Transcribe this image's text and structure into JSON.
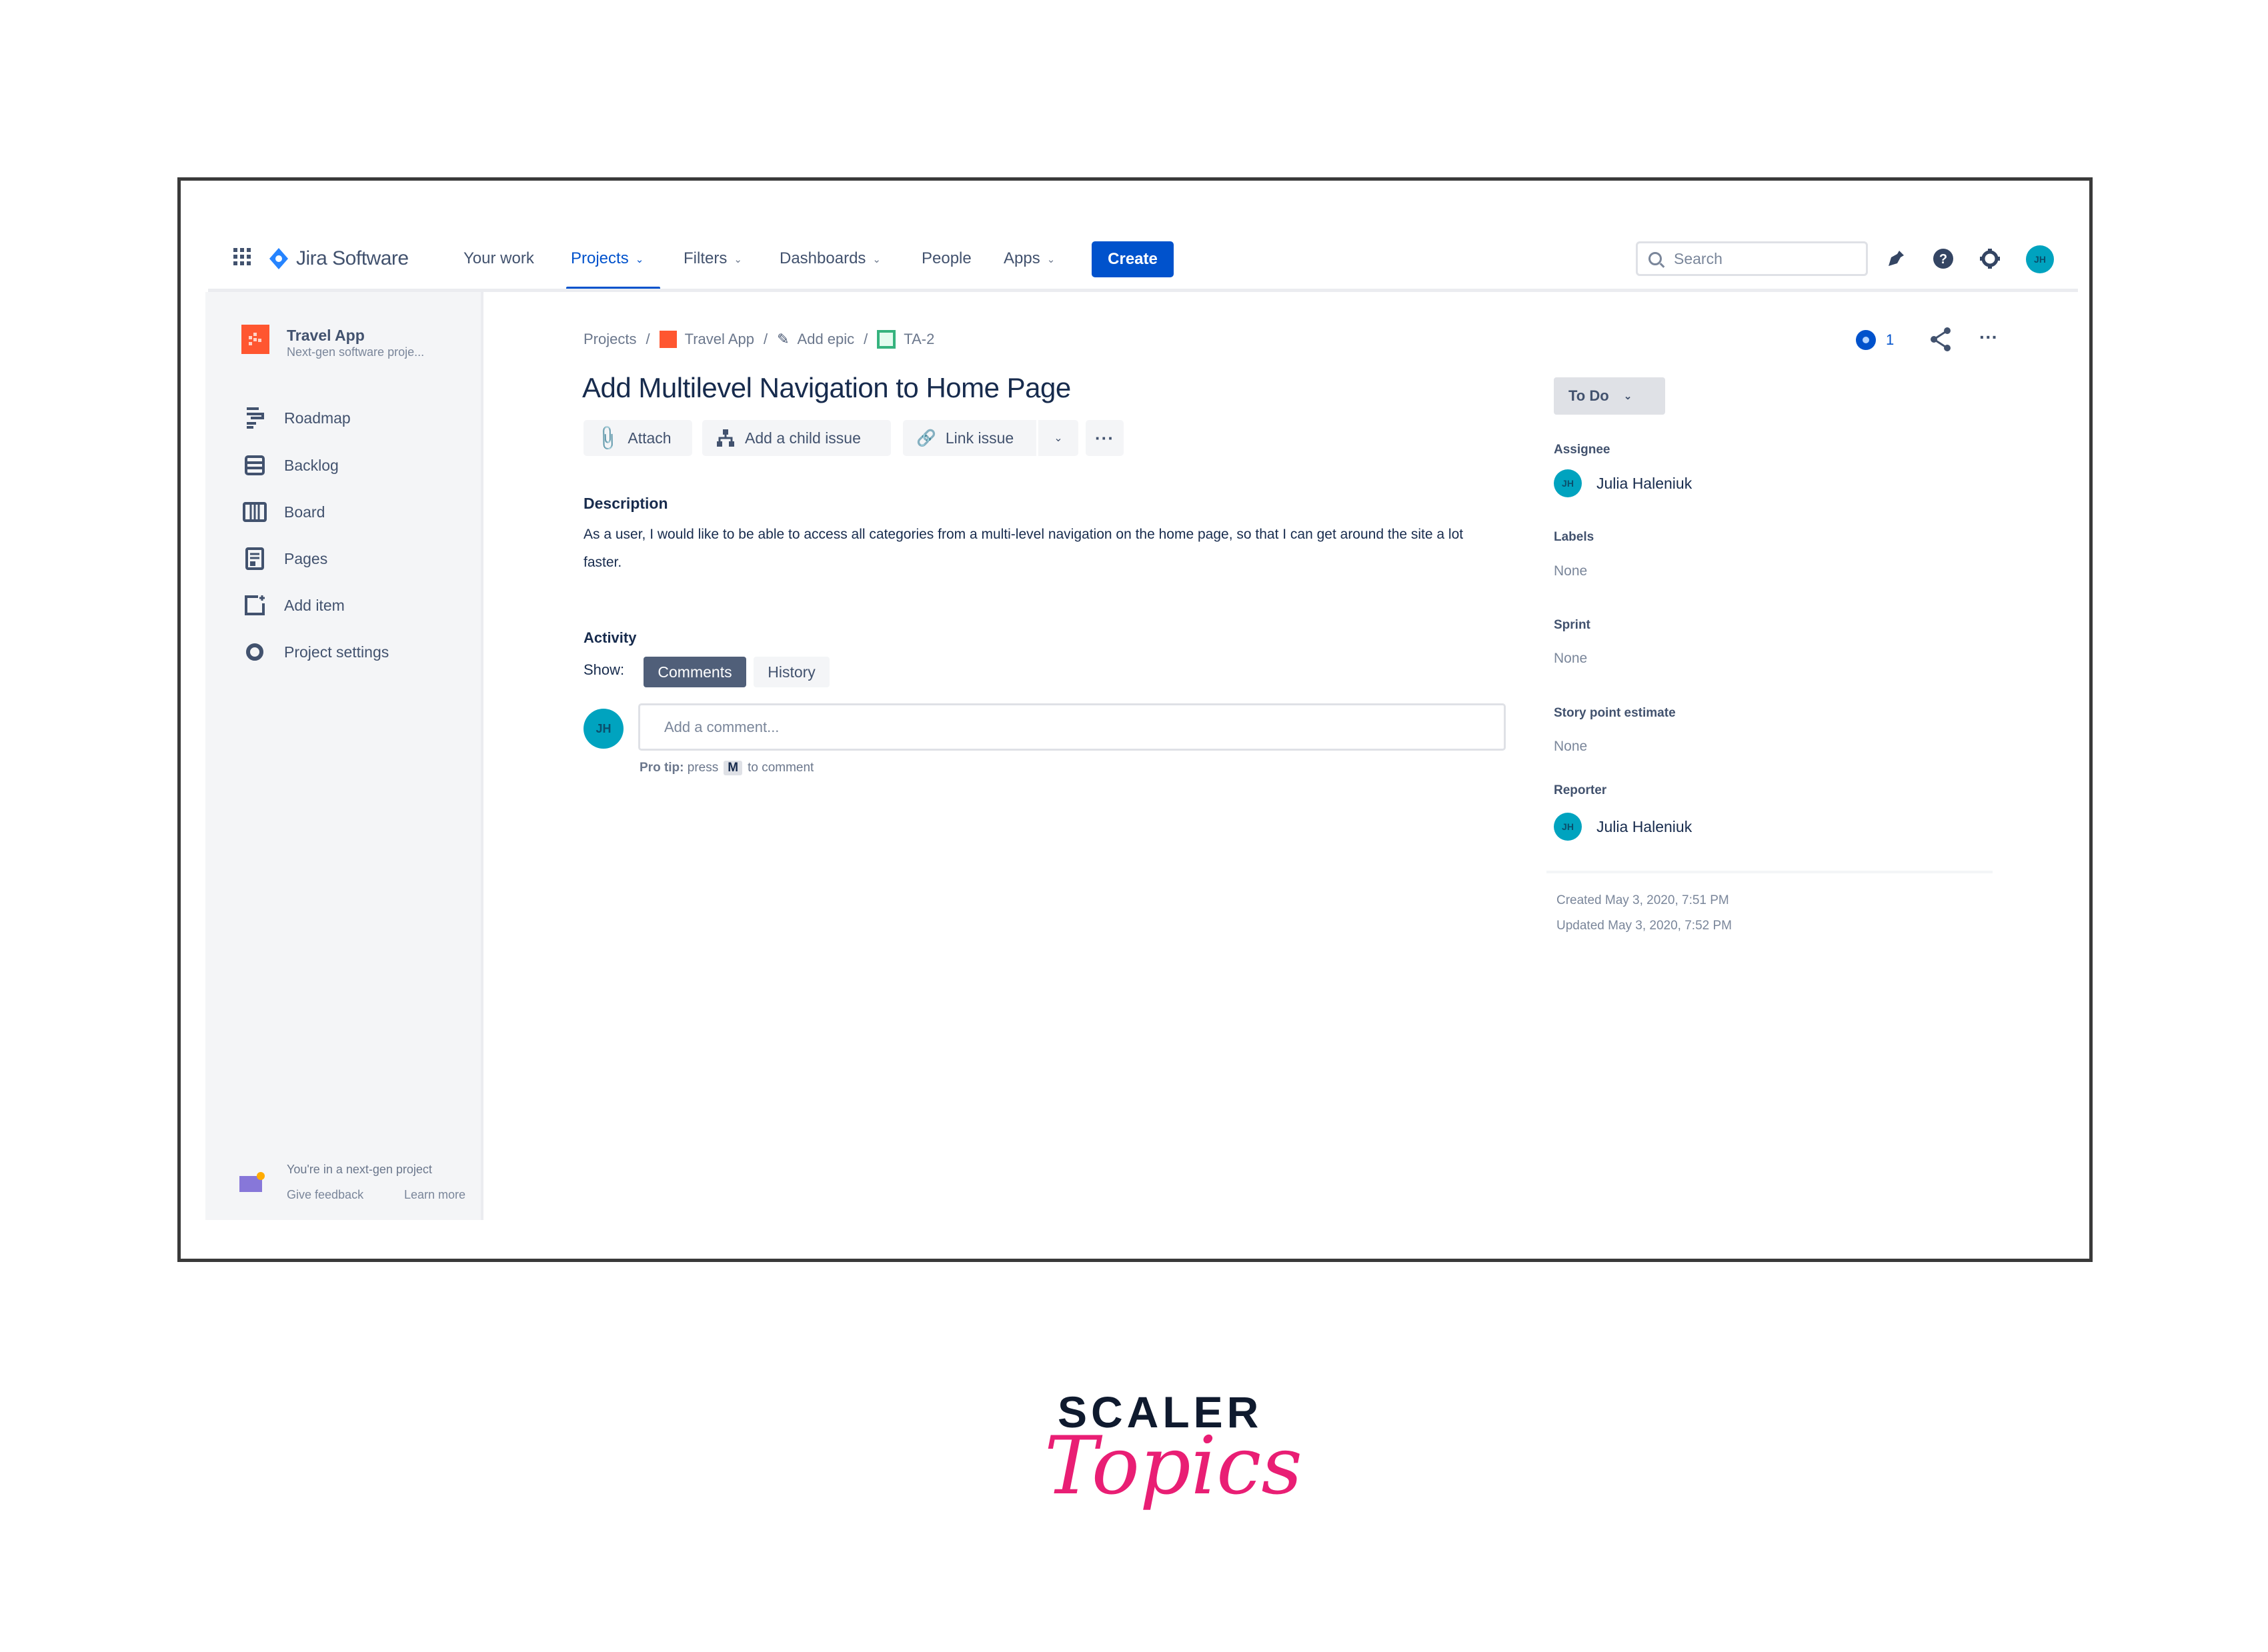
{
  "header": {
    "app_name": "Jira Software",
    "nav": [
      {
        "label": "Your work",
        "dropdown": false,
        "active": false
      },
      {
        "label": "Projects",
        "dropdown": true,
        "active": true
      },
      {
        "label": "Filters",
        "dropdown": true,
        "active": false
      },
      {
        "label": "Dashboards",
        "dropdown": true,
        "active": false
      },
      {
        "label": "People",
        "dropdown": false,
        "active": false
      },
      {
        "label": "Apps",
        "dropdown": true,
        "active": false
      }
    ],
    "create_label": "Create",
    "search_placeholder": "Search",
    "icons": [
      "notifications-icon",
      "help-icon",
      "settings-icon"
    ],
    "user_initials": "JH",
    "accent_color": "#0052cc"
  },
  "sidebar": {
    "project_name": "Travel App",
    "project_type": "Next-gen software proje...",
    "items": [
      {
        "label": "Roadmap",
        "icon": "roadmap-icon"
      },
      {
        "label": "Backlog",
        "icon": "backlog-icon"
      },
      {
        "label": "Board",
        "icon": "board-icon"
      },
      {
        "label": "Pages",
        "icon": "pages-icon"
      },
      {
        "label": "Add item",
        "icon": "add-item-icon"
      },
      {
        "label": "Project settings",
        "icon": "settings-icon"
      }
    ],
    "footer": {
      "message": "You're in a next-gen project",
      "feedback_label": "Give feedback",
      "learn_more_label": "Learn more"
    }
  },
  "issue": {
    "breadcrumb": [
      "Projects",
      "Travel App",
      "Add epic",
      "TA-2"
    ],
    "title": "Add Multilevel Navigation to Home Page",
    "actions": {
      "attach": "Attach",
      "add_child": "Add a child issue",
      "link_issue": "Link issue"
    },
    "description_label": "Description",
    "description": "As a user, I would like to be able to access all categories from a multi-level navigation on the home page, so that I can get around the site a lot faster.",
    "activity": {
      "label": "Activity",
      "show_label": "Show:",
      "tabs": [
        {
          "label": "Comments",
          "active": true
        },
        {
          "label": "History",
          "active": false
        }
      ],
      "comment_placeholder": "Add a comment...",
      "pro_tip_prefix": "Pro tip:",
      "pro_tip_press": "press",
      "pro_tip_key": "M",
      "pro_tip_suffix": "to comment",
      "user_initials": "JH"
    }
  },
  "details": {
    "watchers": "1",
    "status": "To Do",
    "assignee_label": "Assignee",
    "assignee": "Julia Haleniuk",
    "assignee_initials": "JH",
    "labels_label": "Labels",
    "labels_value": "None",
    "sprint_label": "Sprint",
    "sprint_value": "None",
    "story_points_label": "Story point estimate",
    "story_points_value": "None",
    "reporter_label": "Reporter",
    "reporter": "Julia Haleniuk",
    "reporter_initials": "JH",
    "created": "Created May 3, 2020, 7:51 PM",
    "updated": "Updated May 3, 2020, 7:52 PM"
  },
  "branding": {
    "line1": "SCALER",
    "line2": "Topics"
  }
}
